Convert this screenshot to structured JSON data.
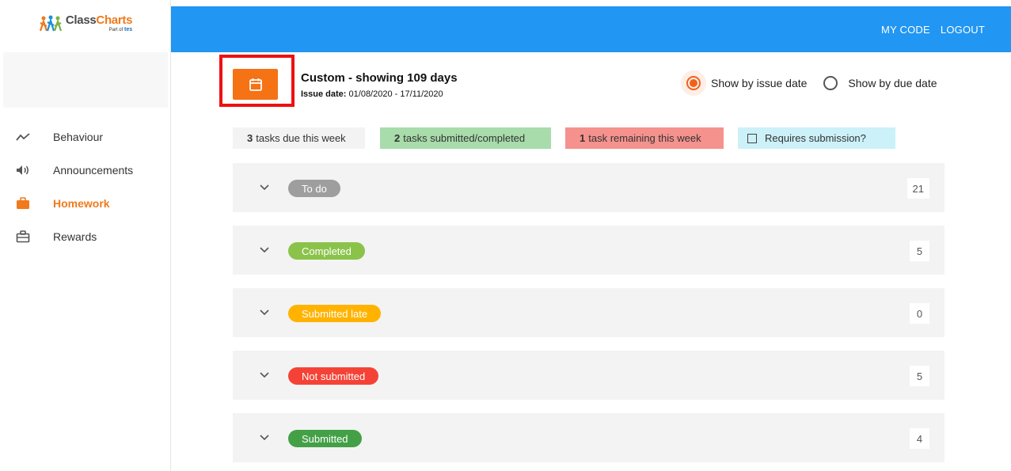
{
  "app": {
    "logo_class": "Class",
    "logo_charts": "Charts",
    "logo_part_of": "Part of",
    "logo_tes": "tes"
  },
  "topbar": {
    "my_code": "MY CODE",
    "logout": "LOGOUT"
  },
  "sidebar": {
    "items": [
      {
        "label": "Behaviour",
        "icon": "trend-line-icon",
        "active": false
      },
      {
        "label": "Announcements",
        "icon": "speaker-icon",
        "active": false
      },
      {
        "label": "Homework",
        "icon": "briefcase-icon",
        "active": true
      },
      {
        "label": "Rewards",
        "icon": "gift-box-icon",
        "active": false
      }
    ]
  },
  "header": {
    "calendar_icon": "calendar-icon",
    "range_title": "Custom - showing 109 days",
    "issue_date_label": "Issue date:",
    "issue_date_value": "01/08/2020 - 17/11/2020"
  },
  "view_toggle": {
    "options": [
      {
        "label": "Show by issue date",
        "selected": true
      },
      {
        "label": "Show by due date",
        "selected": false
      }
    ]
  },
  "summary": {
    "due_count": "3",
    "due_text": "tasks due this week",
    "submitted_count": "2",
    "submitted_text": "tasks submitted/completed",
    "remaining_count": "1",
    "remaining_text": "task remaining this week",
    "requires_submission": "Requires submission?"
  },
  "statuses": [
    {
      "label": "To do",
      "count": "21",
      "color": "#9e9e9e"
    },
    {
      "label": "Completed",
      "count": "5",
      "color": "#8bc34a"
    },
    {
      "label": "Submitted late",
      "count": "0",
      "color": "#ffb300"
    },
    {
      "label": "Not submitted",
      "count": "5",
      "color": "#f44336"
    },
    {
      "label": "Submitted",
      "count": "4",
      "color": "#43a047"
    }
  ],
  "colors": {
    "accent": "#f57215",
    "topbar": "#2196f3",
    "highlight": "#ee1111"
  }
}
